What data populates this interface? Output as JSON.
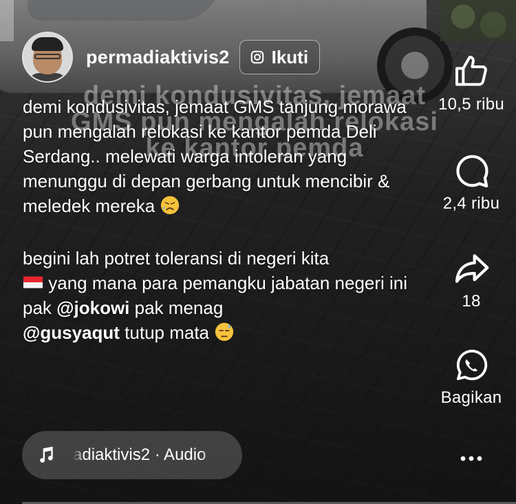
{
  "post": {
    "username": "permadiaktivis2",
    "follow_label": "Ikuti",
    "overlay_lines": [
      "demi kondusivitas, jemaat",
      "GMS pun mengalah relokasi",
      "ke kantor pemda"
    ],
    "caption": {
      "p1": "demi kondusivitas, jemaat GMS tanjung morawa pun mengalah relokasi ke kantor pemda Deli Serdang.. melewati warga intoleran yang menunggu di depan gerbang untuk mencibir & meledek mereka",
      "p2_a": "begini lah potret toleransi di negeri kita",
      "p2_b": "yang mana para pemangku jabatan negeri ini pak",
      "mention_1": "@jokowi",
      "p2_c": "pak menag",
      "mention_2": "@gusyaqut",
      "p2_d": "tutup mata"
    }
  },
  "actions": {
    "like_count": "10,5 ribu",
    "comment_count": "2,4 ribu",
    "share_count": "18",
    "whatsapp_label": "Bagikan"
  },
  "audio": {
    "label": "adiaktivis2 · Audio"
  },
  "icons": [
    "instagram-icon",
    "like-icon",
    "comment-icon",
    "share-icon",
    "whatsapp-icon",
    "more-icon",
    "music-icon",
    "sad-relieved-emoji",
    "indonesia-flag-emoji",
    "downcast-sweat-emoji"
  ]
}
